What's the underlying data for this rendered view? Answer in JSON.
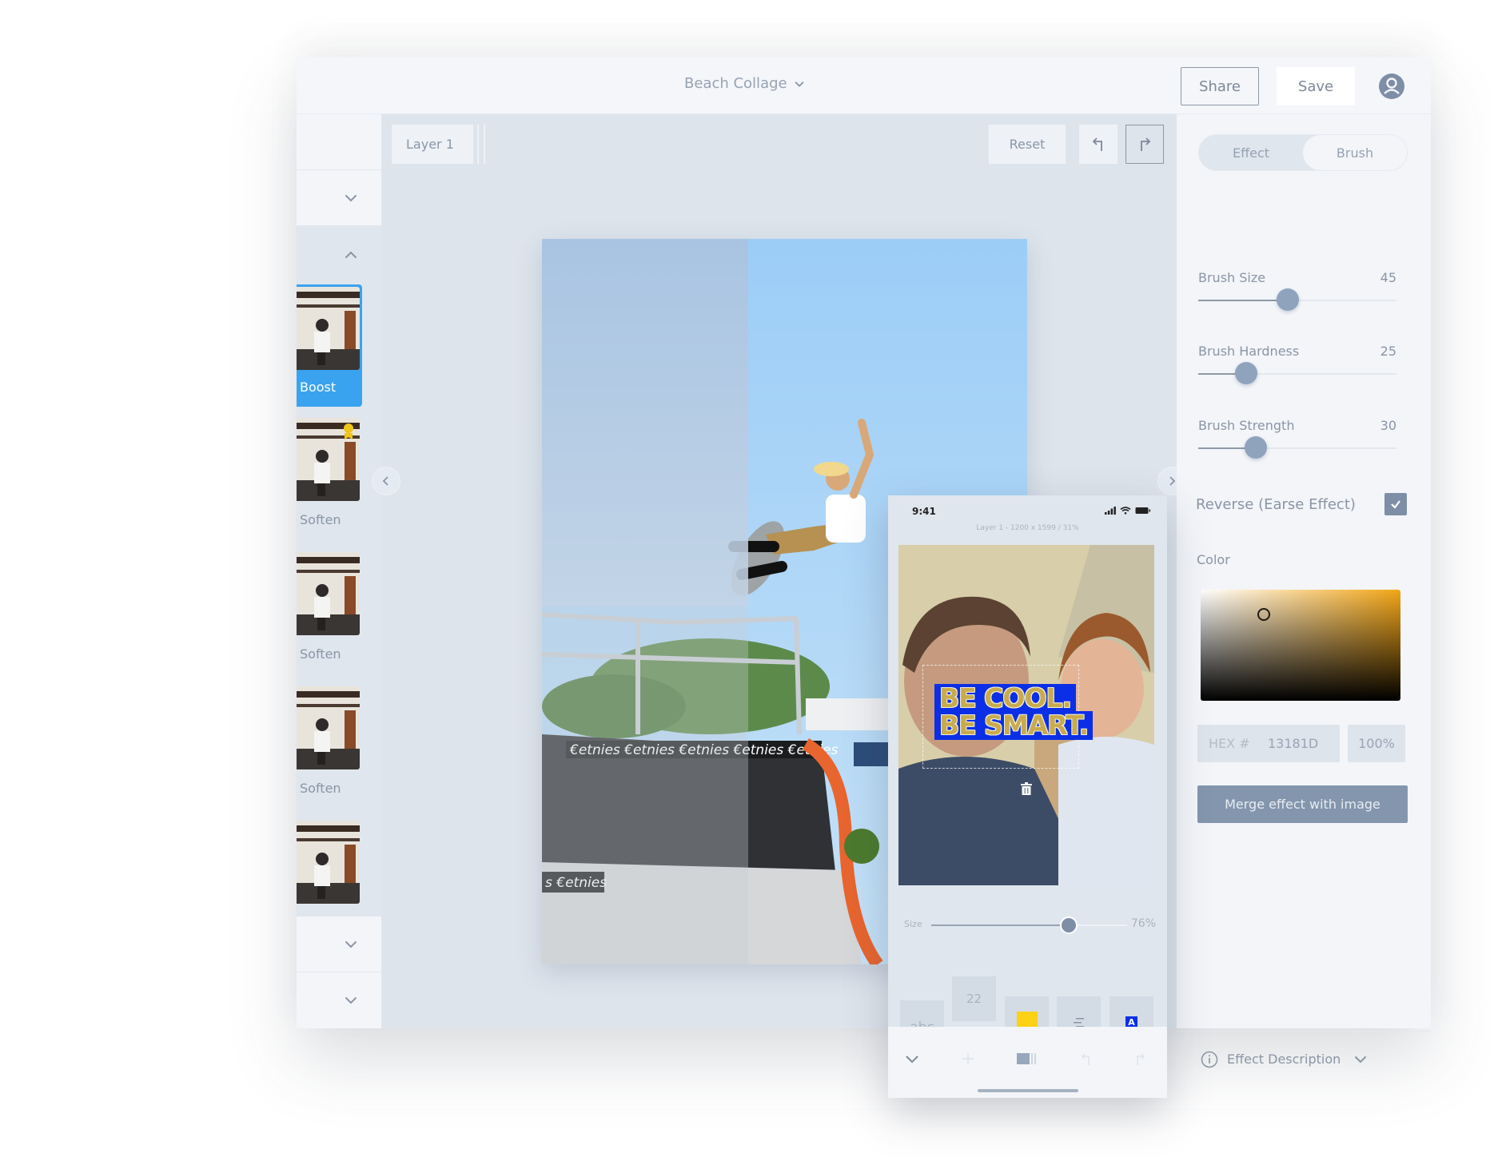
{
  "header": {
    "document_title": "Beach Collage",
    "share_label": "Share",
    "save_label": "Save",
    "avatar_icon": "user-avatar-icon"
  },
  "sidebar": {
    "items": [
      {
        "label": "Boost",
        "active": true,
        "badge": false
      },
      {
        "label": "Soften",
        "active": false,
        "badge": true
      },
      {
        "label": "Soften",
        "active": false,
        "badge": false
      },
      {
        "label": "Soften",
        "active": false,
        "badge": false
      },
      {
        "label": "",
        "active": false,
        "badge": false
      }
    ]
  },
  "canvas": {
    "layer_tab_label": "Layer 1",
    "reset_label": "Reset",
    "undo_icon": "undo-icon",
    "redo_icon": "redo-icon",
    "prev_icon": "chevron-left-icon",
    "next_icon": "chevron-right-icon",
    "photo_watermark": "etnies"
  },
  "right_panel": {
    "tabs": [
      {
        "label": "Effect",
        "active": false
      },
      {
        "label": "Brush",
        "active": true
      }
    ],
    "sliders": [
      {
        "label": "Brush Size",
        "value": "45",
        "fraction": 0.45
      },
      {
        "label": "Brush Hardness",
        "value": "25",
        "fraction": 0.24
      },
      {
        "label": "Brush Strength",
        "value": "30",
        "fraction": 0.29
      }
    ],
    "reverse_label": "Reverse (Earse Effect)",
    "reverse_checked": true,
    "color_label": "Color",
    "color_hue": "#f2a516",
    "hex_prefix": "HEX #",
    "hex_value": "13181D",
    "alpha_value": "100%",
    "merge_label": "Merge effect with image",
    "effect_description_label": "Effect Description"
  },
  "phone": {
    "time": "9:41",
    "subtitle": "Layer 1 - 1200 x 1599 / 31%",
    "sticker_lines": [
      "BE COOL.",
      "BE SMART."
    ],
    "sticker_bg": "#0b2fe6",
    "sticker_text_color": "#c8ab4e",
    "size_label": "Size",
    "size_value": "76%",
    "size_fraction": 0.7,
    "tools": {
      "text_style": "abc",
      "font_size": "22",
      "color_swatch": "#fcd116",
      "align_icon": "align-icon",
      "text_bg_icon": "A"
    }
  }
}
